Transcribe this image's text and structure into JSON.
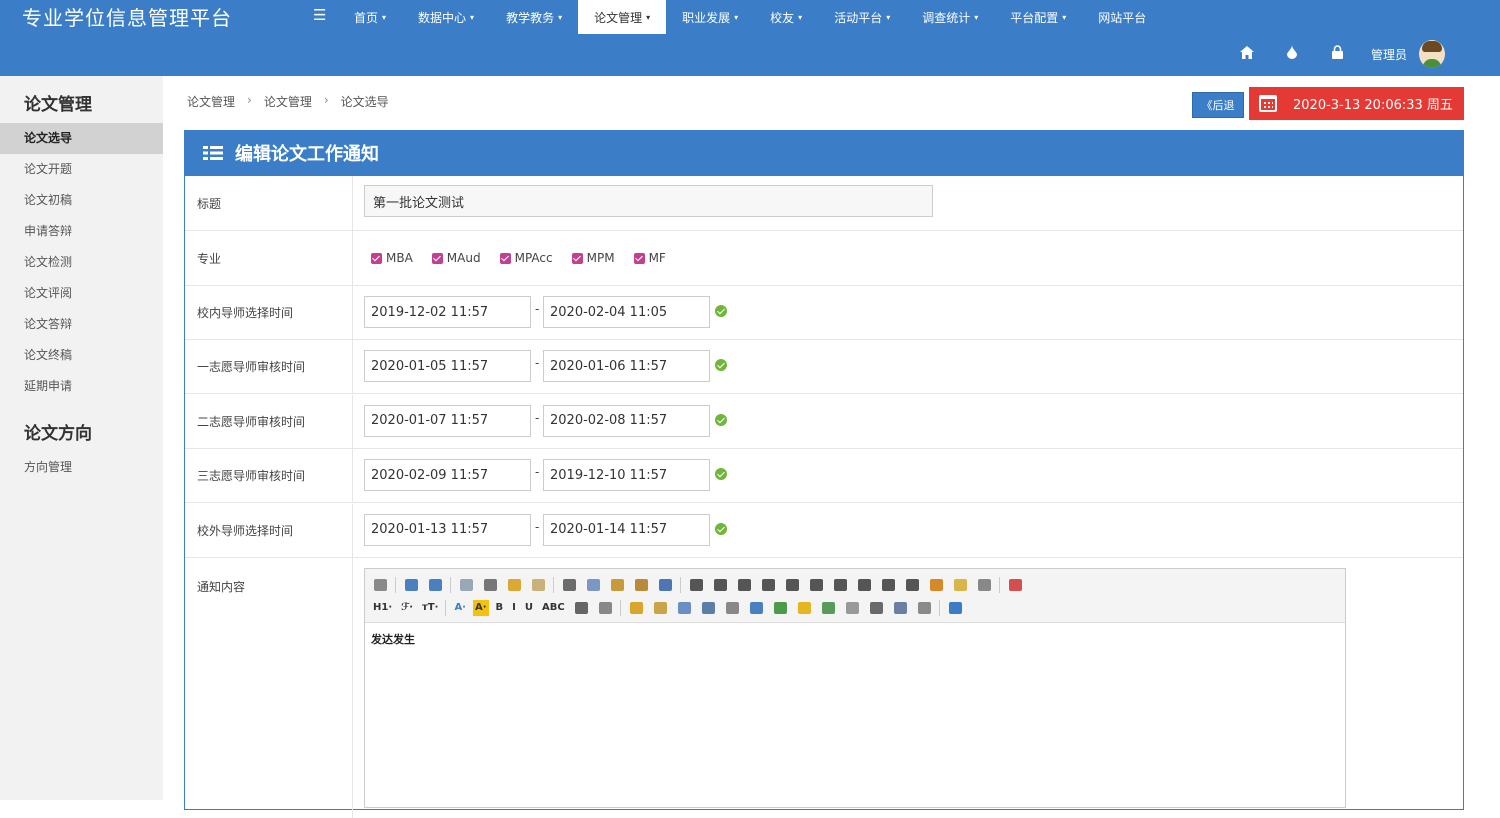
{
  "header": {
    "brand": "专业学位信息管理平台",
    "menu_icon": "hamburger-icon",
    "nav": [
      {
        "label": "首页",
        "caret": "▾",
        "active": false
      },
      {
        "label": "数据中心",
        "caret": "▾",
        "active": false
      },
      {
        "label": "教学教务",
        "caret": "▾",
        "active": false
      },
      {
        "label": "论文管理",
        "caret": "▾",
        "active": true
      },
      {
        "label": "职业发展",
        "caret": "▾",
        "active": false
      },
      {
        "label": "校友",
        "caret": "▾",
        "active": false
      },
      {
        "label": "活动平台",
        "caret": "▾",
        "active": false
      },
      {
        "label": "调查统计",
        "caret": "▾",
        "active": false
      },
      {
        "label": "平台配置",
        "caret": "▾",
        "active": false
      },
      {
        "label": "网站平台",
        "caret": "",
        "active": false
      }
    ],
    "icons": {
      "home": "⌂",
      "drop": "●",
      "lock": "🔒"
    },
    "user_label": "管理员",
    "accent": "#3b7ec7"
  },
  "sidebar": {
    "sections": [
      {
        "title": "论文管理",
        "items": [
          "论文选导",
          "论文开题",
          "论文初稿",
          "申请答辩",
          "论文检测",
          "论文评阅",
          "论文答辩",
          "论文终稿",
          "延期申请"
        ]
      },
      {
        "title": "论文方向",
        "items": [
          "方向管理"
        ]
      }
    ],
    "active_item": "论文选导"
  },
  "breadcrumb": [
    "论文管理",
    "论文管理",
    "论文选导"
  ],
  "breadcrumb_sep": "›",
  "back_label": "《后退",
  "clock_text": "2020-3-13 20:06:33 周五",
  "clock_color": "#e53935",
  "form": {
    "heading": "编辑论文工作通知",
    "title_label": "标题",
    "title_value": "第一批论文测试",
    "major_label": "专业",
    "majors": [
      "MBA",
      "MAud",
      "MPAcc",
      "MPM",
      "MF"
    ],
    "checkbox_color": "#c2418f",
    "date_sep": "-",
    "date_rows": [
      {
        "label": "校内导师选择时间",
        "from": "2019-12-02 11:57",
        "to": "2020-02-04 11:05"
      },
      {
        "label": "一志愿导师审核时间",
        "from": "2020-01-05 11:57",
        "to": "2020-01-06 11:57"
      },
      {
        "label": "二志愿导师审核时间",
        "from": "2020-01-07 11:57",
        "to": "2020-02-08 11:57"
      },
      {
        "label": "三志愿导师审核时间",
        "from": "2020-02-09 11:57",
        "to": "2019-12-10 11:57"
      },
      {
        "label": "校外导师选择时间",
        "from": "2020-01-13 11:57",
        "to": "2020-01-14 11:57"
      }
    ],
    "content_label": "通知内容",
    "content_value": "发达发生",
    "toolbar_text": {
      "h1": "H1·",
      "font": "ℱ·",
      "size": "тT·",
      "color": "A·",
      "bg": "A·",
      "bold": "B",
      "italic": "I",
      "underline": "U",
      "strike": "ABC"
    }
  }
}
